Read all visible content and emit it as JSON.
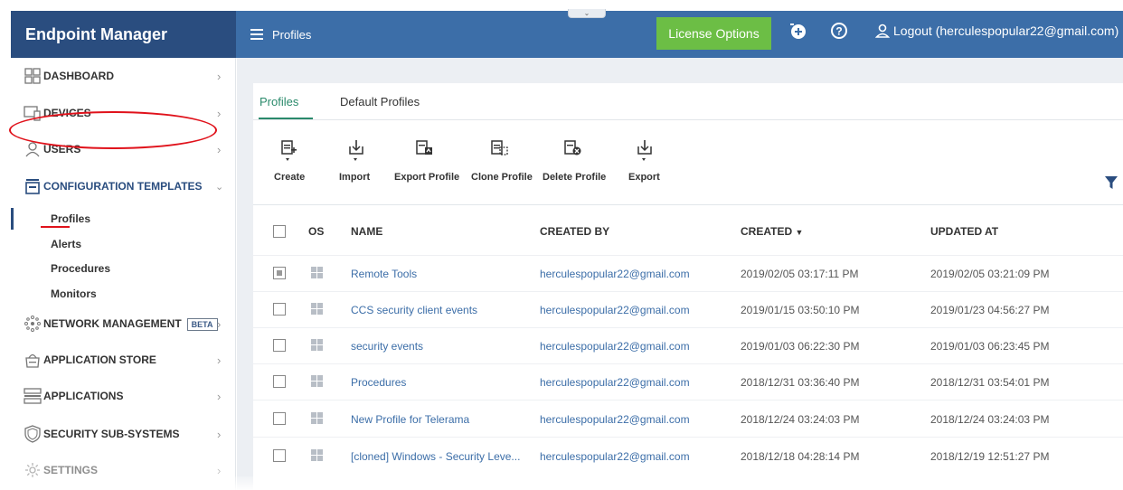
{
  "header": {
    "brand": "Endpoint Manager",
    "page_title": "Profiles",
    "license_button": "License Options",
    "logout": "Logout (herculespopular22@gmail.com)",
    "colors": {
      "brand_bg": "#2a4d7f",
      "topbar_bg": "#3c6ea8",
      "license_bg": "#6cbe45"
    }
  },
  "sidebar": {
    "items": [
      {
        "label": "DASHBOARD",
        "icon": "dashboard-icon"
      },
      {
        "label": "DEVICES",
        "icon": "devices-icon"
      },
      {
        "label": "USERS",
        "icon": "user-icon"
      },
      {
        "label": "CONFIGURATION TEMPLATES",
        "icon": "templates-icon"
      },
      {
        "label": "NETWORK MANAGEMENT",
        "icon": "network-icon",
        "badge": "BETA"
      },
      {
        "label": "APPLICATION STORE",
        "icon": "store-icon"
      },
      {
        "label": "APPLICATIONS",
        "icon": "applications-icon"
      },
      {
        "label": "SECURITY SUB-SYSTEMS",
        "icon": "shield-icon"
      },
      {
        "label": "SETTINGS",
        "icon": "gear-icon"
      }
    ],
    "sub_items": [
      "Profiles",
      "Alerts",
      "Procedures",
      "Monitors"
    ]
  },
  "tabs": [
    "Profiles",
    "Default Profiles"
  ],
  "toolbar": [
    "Create",
    "Import",
    "Export Profile",
    "Clone Profile",
    "Delete Profile",
    "Export"
  ],
  "table": {
    "columns": [
      "OS",
      "NAME",
      "CREATED BY",
      "CREATED",
      "UPDATED AT"
    ],
    "rows": [
      {
        "name": "Remote Tools",
        "created_by": "herculespopular22@gmail.com",
        "created": "2019/02/05 03:17:11 PM",
        "updated": "2019/02/05 03:21:09 PM"
      },
      {
        "name": "CCS security client events",
        "created_by": "herculespopular22@gmail.com",
        "created": "2019/01/15 03:50:10 PM",
        "updated": "2019/01/23 04:56:27 PM"
      },
      {
        "name": "security events",
        "created_by": "herculespopular22@gmail.com",
        "created": "2019/01/03 06:22:30 PM",
        "updated": "2019/01/03 06:23:45 PM"
      },
      {
        "name": "Procedures",
        "created_by": "herculespopular22@gmail.com",
        "created": "2018/12/31 03:36:40 PM",
        "updated": "2018/12/31 03:54:01 PM"
      },
      {
        "name": "New Profile for Telerama",
        "created_by": "herculespopular22@gmail.com",
        "created": "2018/12/24 03:24:03 PM",
        "updated": "2018/12/24 03:24:03 PM"
      },
      {
        "name": "[cloned] Windows - Security Leve...",
        "created_by": "herculespopular22@gmail.com",
        "created": "2018/12/18 04:28:14 PM",
        "updated": "2018/12/19 12:51:27 PM"
      }
    ]
  }
}
